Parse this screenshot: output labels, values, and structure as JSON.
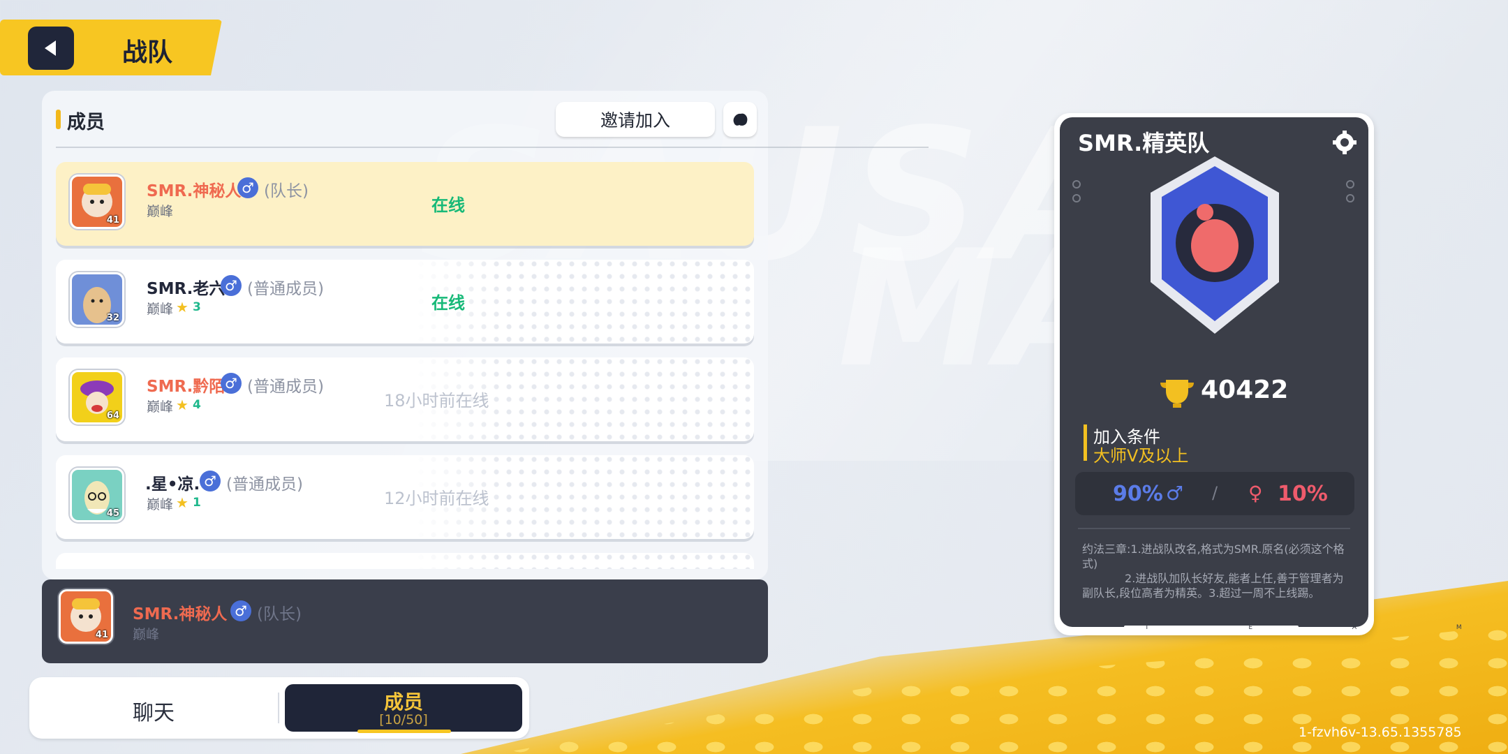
{
  "header": {
    "title": "战队",
    "back_icon": "back-arrow-icon"
  },
  "members_panel": {
    "section_label": "成员",
    "invite_button": "邀请加入",
    "side_icon": "blob-icon",
    "members": [
      {
        "name": "SMR.神秘人",
        "gender": "♂",
        "role": "(队长)",
        "rank": "巅峰",
        "stars": "",
        "level": "41",
        "status": "在线",
        "online": true,
        "name_color": "red",
        "avatar_color": "#e9703d"
      },
      {
        "name": "SMR.老六",
        "gender": "♂",
        "role": "(普通成员)",
        "rank": "巅峰",
        "stars": "3",
        "level": "32",
        "status": "在线",
        "online": true,
        "name_color": "dark",
        "avatar_color": "#6f8fd8"
      },
      {
        "name": "SMR.黔陌",
        "gender": "♂",
        "role": "(普通成员)",
        "rank": "巅峰",
        "stars": "4",
        "level": "64",
        "status": "18小时前在线",
        "online": false,
        "name_color": "red",
        "avatar_color": "#f2d01a"
      },
      {
        "name": ".星•凉.",
        "gender": "♂",
        "role": "(普通成员)",
        "rank": "巅峰",
        "stars": "1",
        "level": "45",
        "status": "12小时前在线",
        "online": false,
        "name_color": "dark",
        "avatar_color": "#7ad1c2"
      }
    ]
  },
  "self_bar": {
    "name": "SMR.神秘人",
    "gender": "♂",
    "role": "(队长)",
    "rank": "巅峰",
    "level": "41"
  },
  "tabs": {
    "chat": "聊天",
    "members": "成员",
    "members_count": "[10/50]"
  },
  "team_card": {
    "name": "SMR.精英队",
    "settings_icon": "gear-icon",
    "score": "40422",
    "join_condition_label": "加入条件",
    "join_condition_value": "大师V及以上",
    "male_percent": "90%",
    "male_icon": "♂",
    "slash": "/",
    "female_icon": "♀",
    "female_percent": "10%",
    "rules": "约法三章:1.进战队改名,格式为SMR.原名(必须这个格式)\n            2.进战队加队长好友,能者上任,善于管理者为副队长,段位高者为精英。3.超过一周不上线踢。",
    "footer": "T E A M"
  },
  "version": "1-fzvh6v-13.65.1355785",
  "colors": {
    "accent_yellow": "#f7c622",
    "online_green": "#17b978",
    "male_blue": "#5b7ce8",
    "female_red": "#ef5b6c"
  }
}
